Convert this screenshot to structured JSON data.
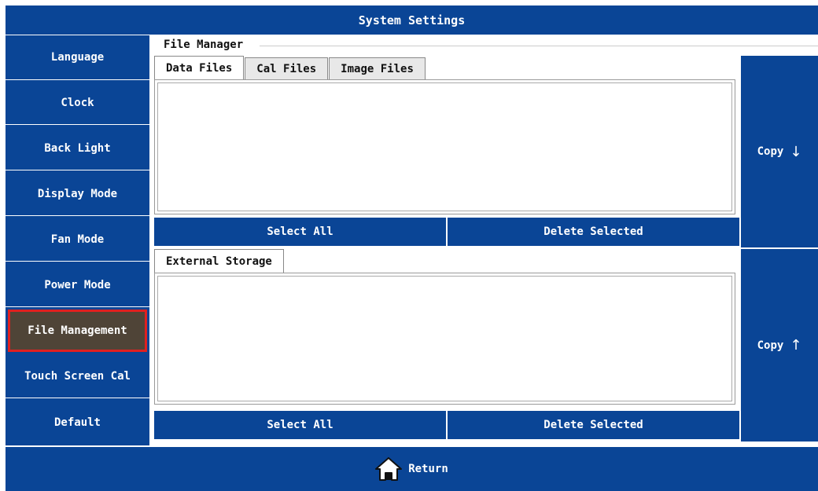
{
  "window": {
    "title": "System Settings"
  },
  "sidebar": {
    "items": [
      {
        "label": "Language"
      },
      {
        "label": "Clock"
      },
      {
        "label": "Back Light"
      },
      {
        "label": "Display Mode"
      },
      {
        "label": "Fan Mode"
      },
      {
        "label": "Power Mode"
      },
      {
        "label": "File Management",
        "active": true
      },
      {
        "label": "Touch Screen Cal"
      },
      {
        "label": "Default"
      }
    ]
  },
  "file_manager": {
    "title": "File Manager",
    "tabs": [
      {
        "label": "Data Files",
        "active": true
      },
      {
        "label": "Cal Files"
      },
      {
        "label": "Image Files"
      }
    ],
    "select_all_label": "Select All",
    "delete_selected_label": "Delete Selected",
    "external_tab_label": "External Storage",
    "ext_select_all_label": "Select All",
    "ext_delete_selected_label": "Delete Selected",
    "copy_down_label": "Copy",
    "copy_up_label": "Copy"
  },
  "footer": {
    "return_label": "Return"
  },
  "colors": {
    "primary": "#0a4596",
    "active_bg": "#4f4437",
    "active_border": "#e02020"
  },
  "icons": {
    "return": "home-icon",
    "copy_down": "arrow-down-icon",
    "copy_up": "arrow-up-icon"
  }
}
